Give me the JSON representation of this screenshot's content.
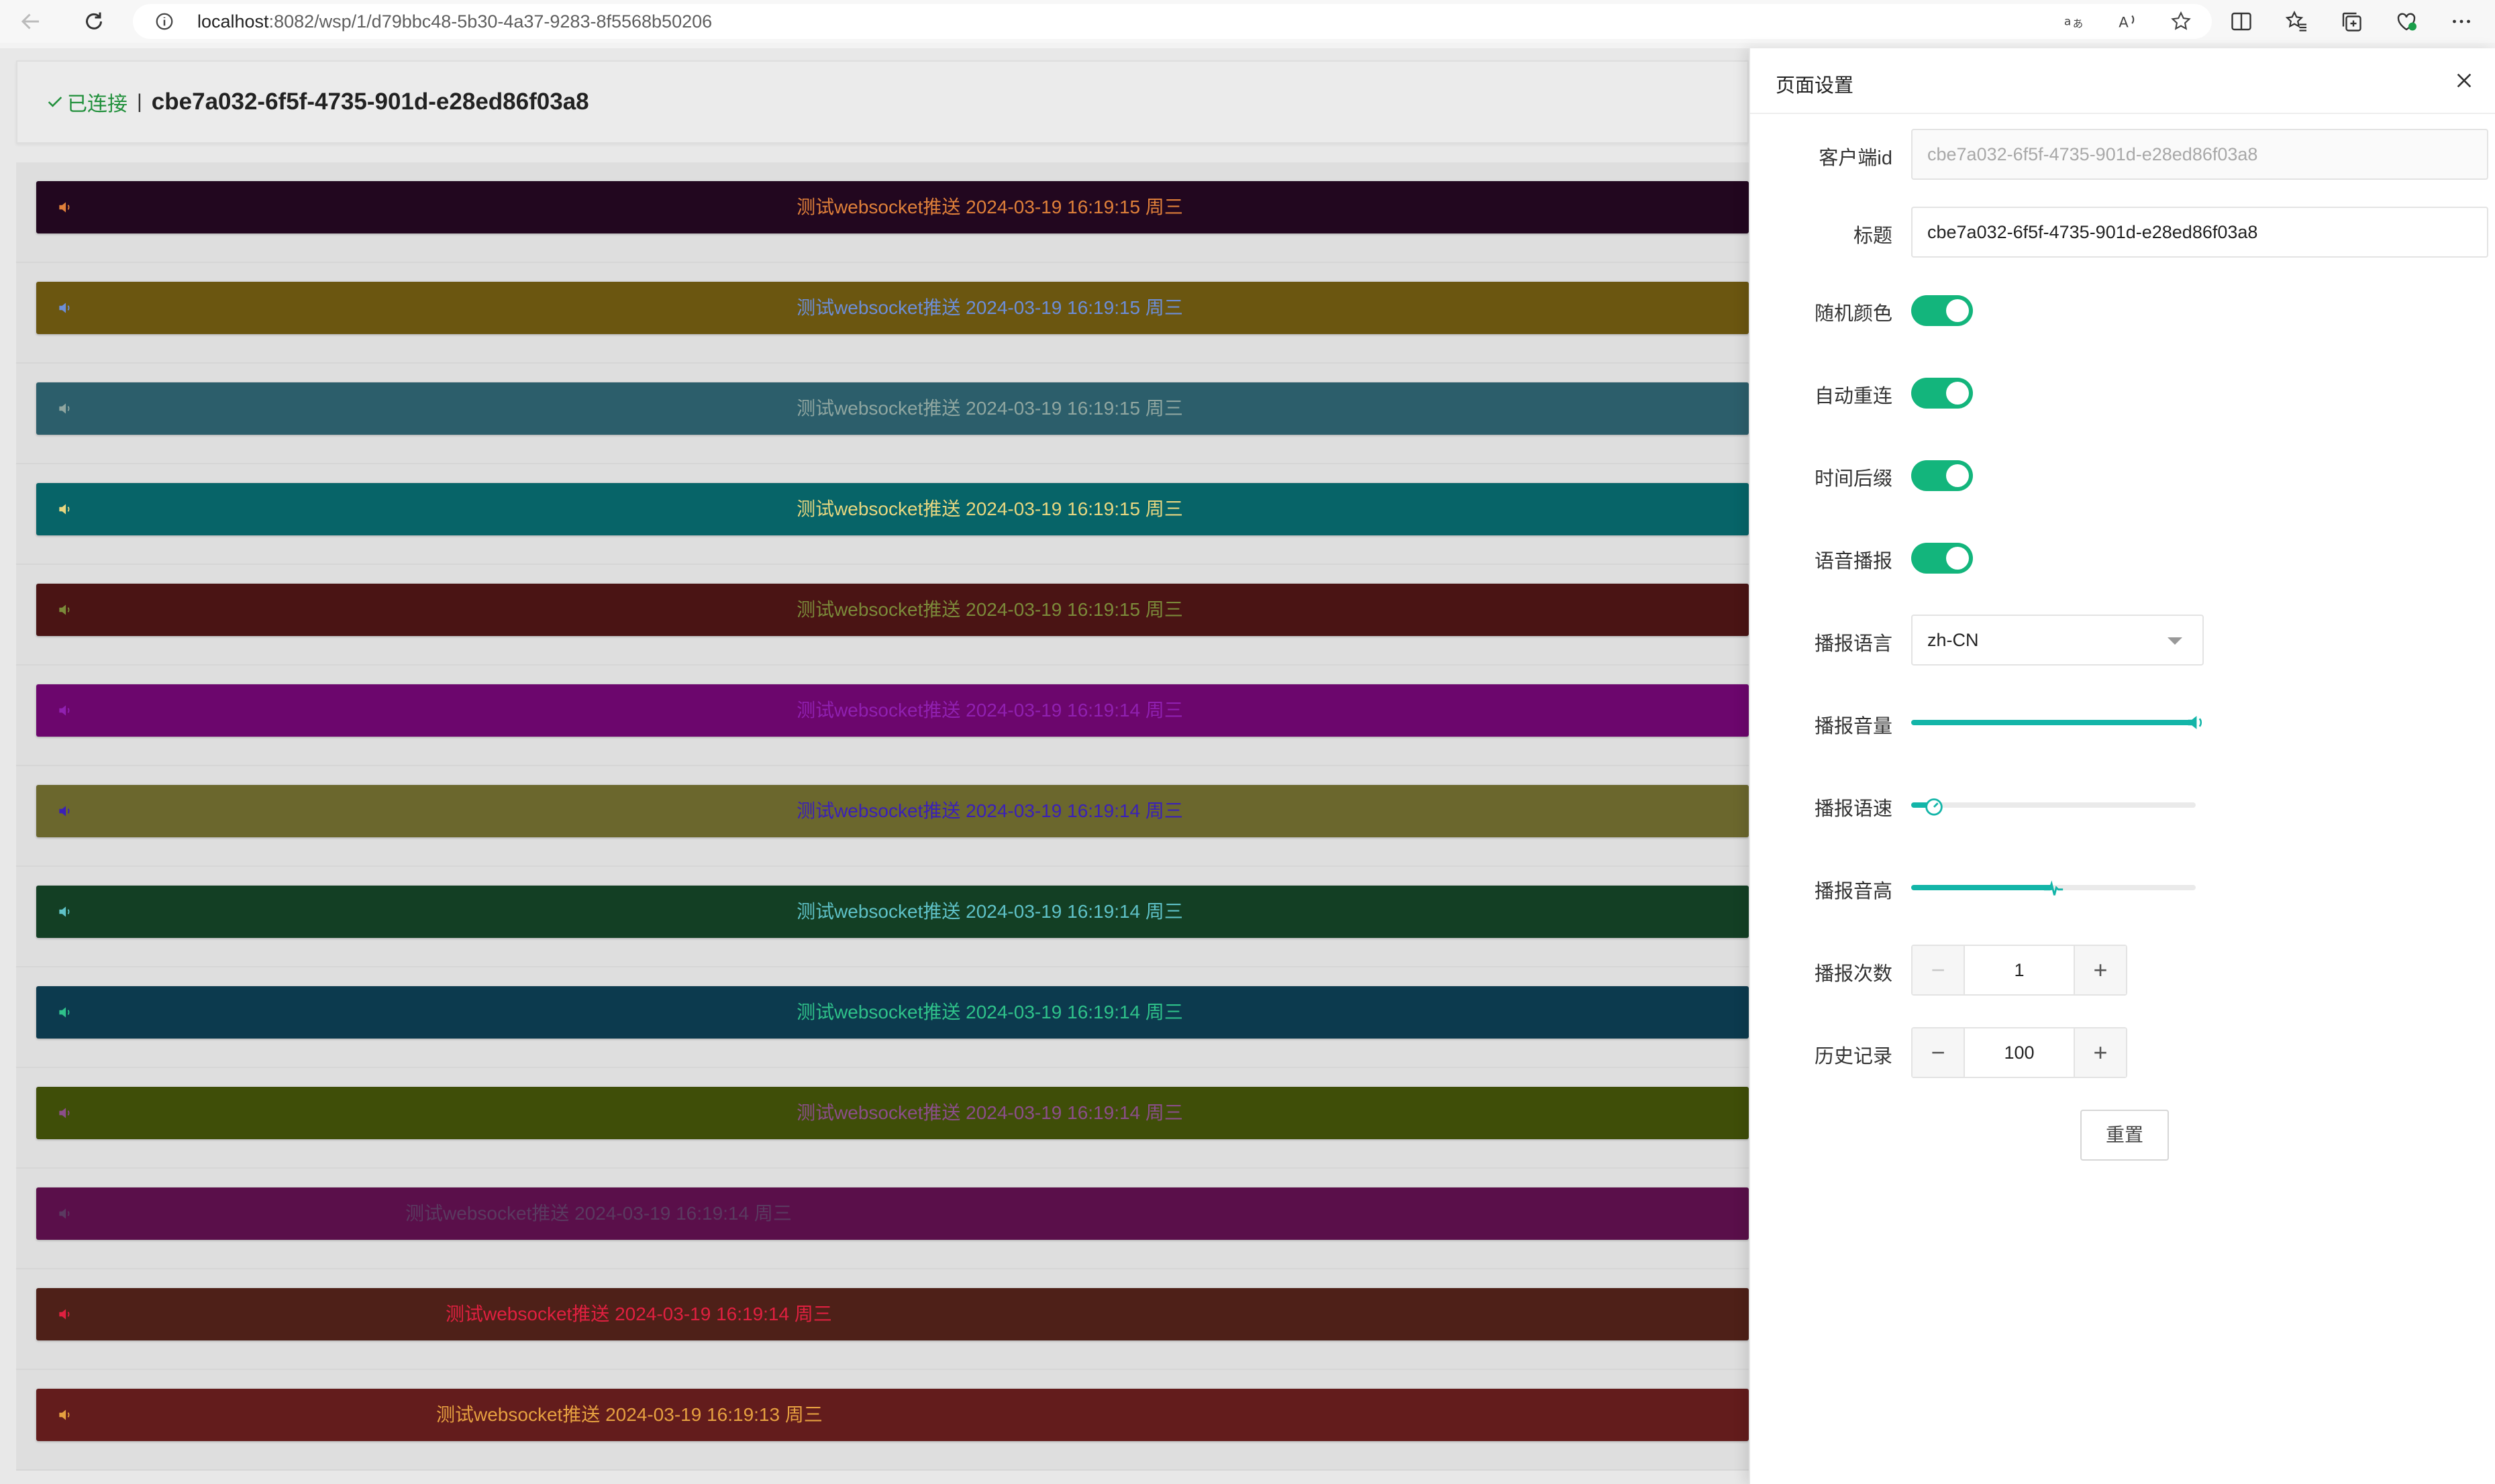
{
  "browser": {
    "url_host": "localhost",
    "url_path": ":8082/wsp/1/d79bbc48-5b30-4a37-9283-8f5568b50206"
  },
  "header": {
    "status": "已连接",
    "separator": "|",
    "title": "cbe7a032-6f5f-4735-901d-e28ed86f03a8"
  },
  "messages": [
    {
      "text": "测试websocket推送 2024-03-19 16:19:15 周三",
      "bg": "#22071f",
      "color": "#e0803a",
      "align": "center"
    },
    {
      "text": "测试websocket推送 2024-03-19 16:19:15 周三",
      "bg": "#6b5610",
      "color": "#6c8ed8",
      "align": "center"
    },
    {
      "text": "测试websocket推送 2024-03-19 16:19:15 周三",
      "bg": "#2c5e6b",
      "color": "#8fa6a0",
      "align": "center"
    },
    {
      "text": "测试websocket推送 2024-03-19 16:19:15 周三",
      "bg": "#076468",
      "color": "#e8d780",
      "align": "center"
    },
    {
      "text": "测试websocket推送 2024-03-19 16:19:15 周三",
      "bg": "#4a1414",
      "color": "#7b8a3a",
      "align": "center"
    },
    {
      "text": "测试websocket推送 2024-03-19 16:19:14 周三",
      "bg": "#6c066d",
      "color": "#9020b0",
      "align": "center"
    },
    {
      "text": "测试websocket推送 2024-03-19 16:19:14 周三",
      "bg": "#6b672d",
      "color": "#3a20b8",
      "align": "center"
    },
    {
      "text": "测试websocket推送 2024-03-19 16:19:14 周三",
      "bg": "#133f24",
      "color": "#5fc2c8",
      "align": "center"
    },
    {
      "text": "测试websocket推送 2024-03-19 16:19:14 周三",
      "bg": "#0c3a4e",
      "color": "#2fc28a",
      "align": "center"
    },
    {
      "text": "测试websocket推送 2024-03-19 16:19:14 周三",
      "bg": "#3f4e08",
      "color": "#8b4e8a",
      "align": "center"
    },
    {
      "text": "测试websocket推送 2024-03-19 16:19:14 周三",
      "bg": "#5a0f4a",
      "color": "#5a3a60",
      "align": "left-550"
    },
    {
      "text": "测试websocket推送 2024-03-19 16:19:14 周三",
      "bg": "#4e2018",
      "color": "#e02040",
      "align": "left-610"
    },
    {
      "text": "测试websocket推送 2024-03-19 16:19:13 周三",
      "bg": "#631c1c",
      "color": "#e6a040",
      "align": "left-596"
    }
  ],
  "drawer": {
    "title": "页面设置",
    "fields": {
      "client_id": {
        "label": "客户端id",
        "value": "cbe7a032-6f5f-4735-901d-e28ed86f03a8"
      },
      "title": {
        "label": "标题",
        "value": "cbe7a032-6f5f-4735-901d-e28ed86f03a8"
      },
      "random_color": {
        "label": "随机颜色",
        "on": true
      },
      "auto_reconnect": {
        "label": "自动重连",
        "on": true
      },
      "time_suffix": {
        "label": "时间后缀",
        "on": true
      },
      "voice_broadcast": {
        "label": "语音播报",
        "on": true
      },
      "language": {
        "label": "播报语言",
        "value": "zh-CN"
      },
      "volume": {
        "label": "播报音量",
        "level": 1.0
      },
      "rate": {
        "label": "播报语速",
        "level": 0.08
      },
      "pitch": {
        "label": "播报音高",
        "level": 0.5
      },
      "times": {
        "label": "播报次数",
        "value": "1"
      },
      "history": {
        "label": "历史记录",
        "value": "100"
      }
    },
    "reset_label": "重置"
  },
  "colors": {
    "accent": "#13b57c",
    "slider": "#13b5a8"
  }
}
